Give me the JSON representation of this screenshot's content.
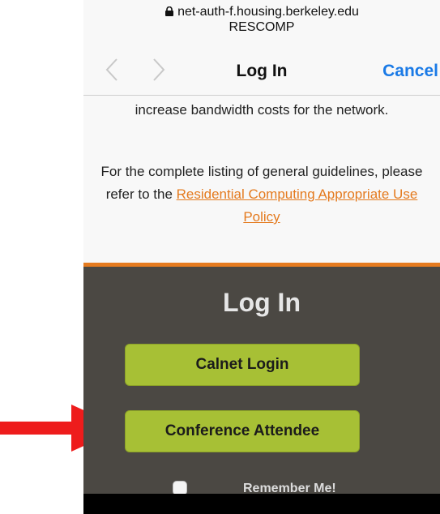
{
  "browser": {
    "url": "net-auth-f.housing.berkeley.edu",
    "site_name": "RESCOMP",
    "lock_icon": "lock-icon"
  },
  "nav": {
    "title": "Log In",
    "cancel_label": "Cancel",
    "back_icon": "chevron-left-icon",
    "forward_icon": "chevron-right-icon"
  },
  "content": {
    "paragraph1": "increase bandwidth costs for the network.",
    "paragraph2_prefix": "For the complete listing of general guidelines, please refer to the ",
    "policy_link": "Residential Computing Appropriate Use Policy"
  },
  "login": {
    "heading": "Log In",
    "calnet_label": "Calnet Login",
    "conference_label": "Conference Attendee",
    "remember_label": "Remember Me!"
  },
  "colors": {
    "accent_blue": "#1a7ae6",
    "orange": "#e57b1f",
    "panel": "#4b4843",
    "button_green": "#a7c035",
    "arrow_red": "#ee1c1c"
  }
}
